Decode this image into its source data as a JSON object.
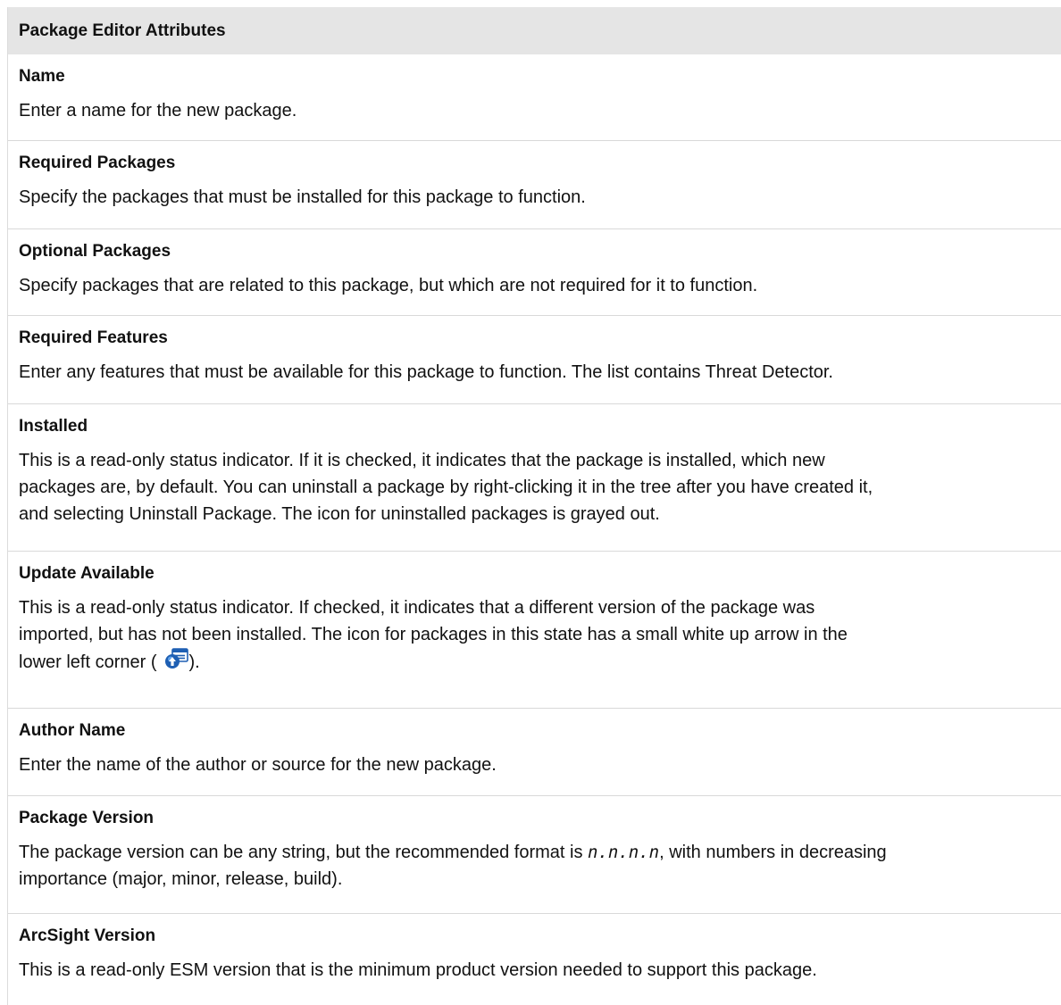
{
  "header": "Package Editor Attributes",
  "rows": [
    {
      "term": "Name",
      "desc": "Enter a name for the new package."
    },
    {
      "term": "Required Packages",
      "desc": "Specify the packages that must be installed for this package to function."
    },
    {
      "term": "Optional Packages",
      "desc": "Specify packages that are related to this package, but which are not required for it to function."
    },
    {
      "term": "Required Features",
      "desc": "Enter any features that must be available for this package to function. The list contains Threat Detector."
    },
    {
      "term": "Installed",
      "desc_line1": "This is a read-only status indicator. If it is checked, it indicates that the package is installed, which new",
      "desc_line2": "packages are, by default. You can uninstall a package by right-clicking it in the tree after you have created it,",
      "desc_line3": "and selecting Uninstall Package. The icon for uninstalled packages is grayed out."
    },
    {
      "term": "Update Available",
      "desc_line1": "This is a read-only status indicator. If checked, it indicates that a different version of the package was",
      "desc_line2": "imported, but has not been installed. The icon for packages in this state has a small white up arrow in the",
      "desc_line3_before": "lower left corner (",
      "desc_line3_after": ").",
      "icon": "package-update-icon"
    },
    {
      "term": "Author Name",
      "desc": "Enter the name of the author or source for the new package."
    },
    {
      "term": "Package Version",
      "desc_before": "The package version can be any string, but the recommended format is ",
      "desc_code": "n.n.n.n",
      "desc_after": ", with numbers in decreasing",
      "desc_line2": "importance (major, minor, release, build)."
    },
    {
      "term": "ArcSight Version",
      "desc": "This is a read-only ESM version that is the minimum product version needed to support this package."
    }
  ],
  "colors": {
    "header_bg": "#e5e5e5",
    "row_border": "#d9d9d9",
    "icon_blue": "#1e5fb3"
  }
}
